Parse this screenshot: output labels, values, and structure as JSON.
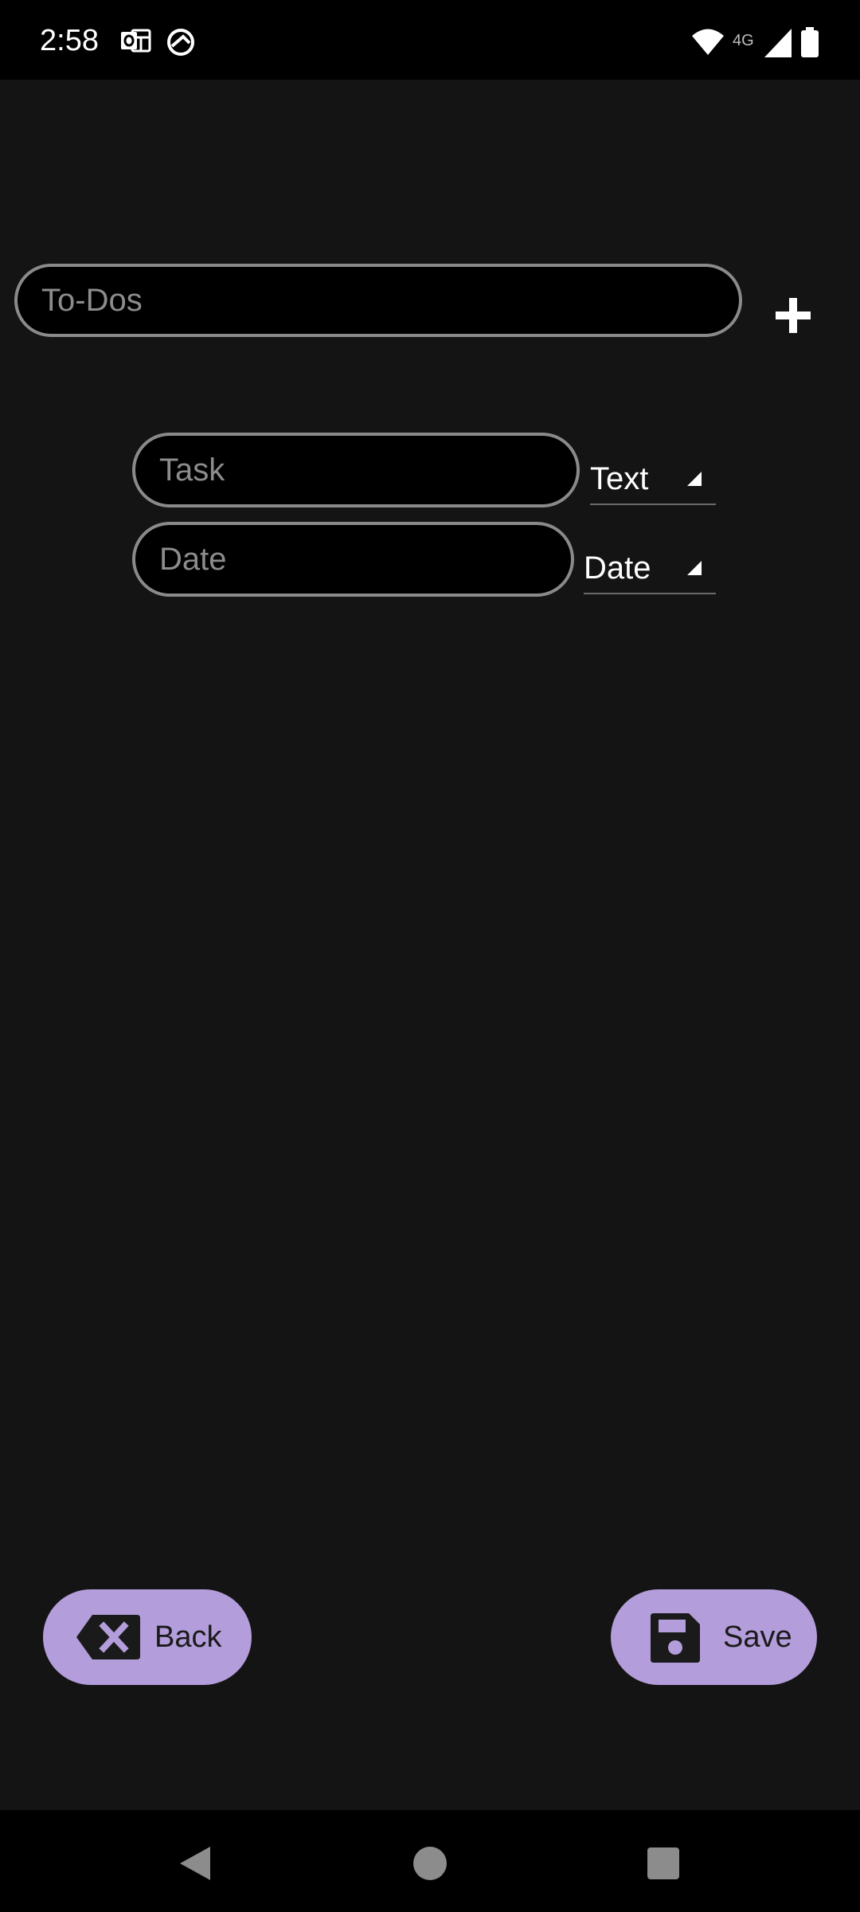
{
  "status_bar": {
    "time": "2:58",
    "network_label": "4G",
    "icons": [
      "outlook-icon",
      "browser-icon",
      "wifi-icon",
      "signal-icon",
      "battery-icon"
    ]
  },
  "form": {
    "title_placeholder": "To-Dos",
    "title_value": "",
    "add_icon": "plus-icon",
    "rows": [
      {
        "placeholder": "Task",
        "type": "Text"
      },
      {
        "placeholder": "Date",
        "type": "Date"
      }
    ]
  },
  "actions": {
    "back_label": "Back",
    "save_label": "Save",
    "accent_color": "#b39ddb"
  },
  "nav": {
    "icons": [
      "nav-back-icon",
      "nav-home-icon",
      "nav-recents-icon"
    ]
  }
}
